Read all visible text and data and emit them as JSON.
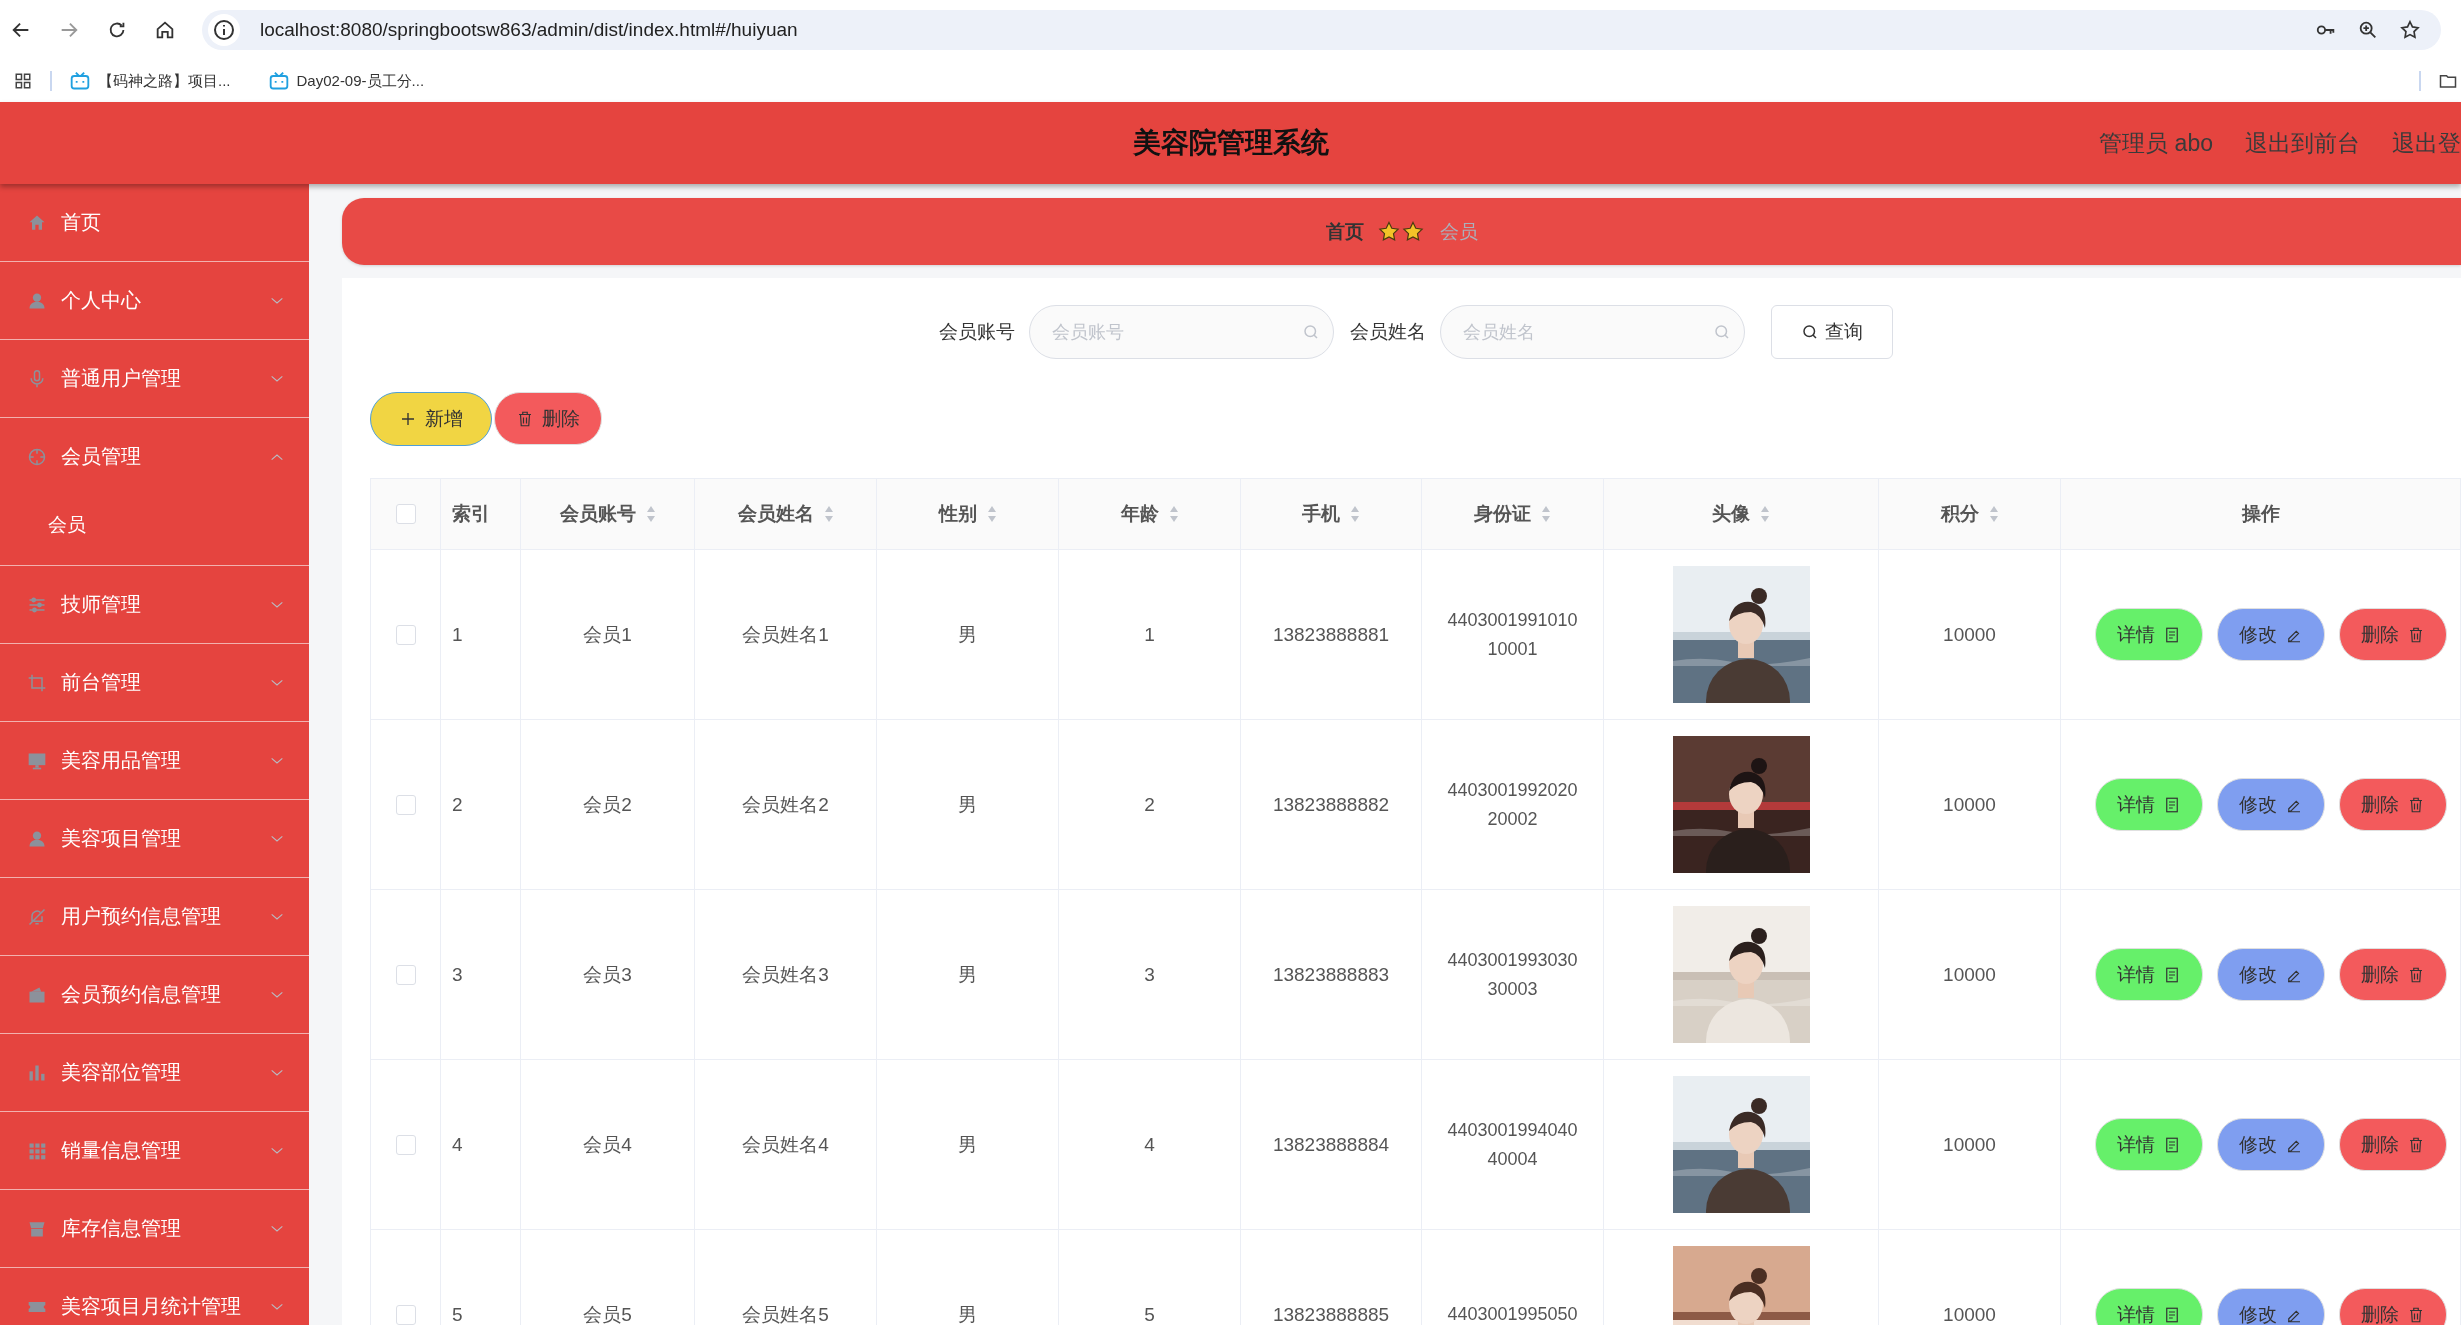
{
  "browser": {
    "url": "localhost:8080/springbootsw863/admin/dist/index.html#/huiyuan",
    "bookmarks": [
      "【码神之路】项目...",
      "Day02-09-员工分..."
    ]
  },
  "header": {
    "title": "美容院管理系统",
    "links": [
      "管理员 abo",
      "退出到前台",
      "退出登"
    ]
  },
  "sidebar": [
    {
      "label": "首页",
      "kind": "link"
    },
    {
      "label": "个人中心",
      "kind": "menu",
      "expanded": false
    },
    {
      "label": "普通用户管理",
      "kind": "menu",
      "expanded": false
    },
    {
      "label": "会员管理",
      "kind": "menu",
      "expanded": true,
      "children": [
        {
          "label": "会员"
        }
      ]
    },
    {
      "label": "技师管理",
      "kind": "menu",
      "expanded": false
    },
    {
      "label": "前台管理",
      "kind": "menu",
      "expanded": false
    },
    {
      "label": "美容用品管理",
      "kind": "menu",
      "expanded": false
    },
    {
      "label": "美容项目管理",
      "kind": "menu",
      "expanded": false
    },
    {
      "label": "用户预约信息管理",
      "kind": "menu",
      "expanded": false
    },
    {
      "label": "会员预约信息管理",
      "kind": "menu",
      "expanded": false
    },
    {
      "label": "美容部位管理",
      "kind": "menu",
      "expanded": false
    },
    {
      "label": "销量信息管理",
      "kind": "menu",
      "expanded": false
    },
    {
      "label": "库存信息管理",
      "kind": "menu",
      "expanded": false
    },
    {
      "label": "美容项目月统计管理",
      "kind": "menu",
      "expanded": false
    }
  ],
  "breadcrumb": [
    "首页",
    "会员"
  ],
  "search": {
    "fields": [
      {
        "label": "会员账号",
        "placeholder": "会员账号"
      },
      {
        "label": "会员姓名",
        "placeholder": "会员姓名"
      }
    ],
    "button": "查询"
  },
  "actions": [
    {
      "label": "新增",
      "kind": "add"
    },
    {
      "label": "删除",
      "kind": "delete"
    }
  ],
  "table": {
    "all_checked": false,
    "columns": [
      {
        "label": "索引",
        "sortable": false
      },
      {
        "label": "会员账号",
        "sortable": true
      },
      {
        "label": "会员姓名",
        "sortable": true
      },
      {
        "label": "性别",
        "sortable": true
      },
      {
        "label": "年龄",
        "sortable": true
      },
      {
        "label": "手机",
        "sortable": true
      },
      {
        "label": "身份证",
        "sortable": true
      },
      {
        "label": "头像",
        "sortable": true
      },
      {
        "label": "积分",
        "sortable": true
      },
      {
        "label": "操作",
        "sortable": false
      }
    ],
    "rows": [
      {
        "checked": false,
        "cells": [
          "1",
          "会员1",
          "会员姓名1",
          "男",
          "1",
          "13823888881",
          "440300199101010001"
        ],
        "points": "10000",
        "buttons": [
          {
            "label": "详情",
            "kind": "detail"
          },
          {
            "label": "修改",
            "kind": "edit"
          },
          {
            "label": "删除",
            "kind": "delete"
          }
        ]
      },
      {
        "checked": false,
        "cells": [
          "2",
          "会员2",
          "会员姓名2",
          "男",
          "2",
          "13823888882",
          "440300199202020002"
        ],
        "points": "10000",
        "buttons": [
          {
            "label": "详情",
            "kind": "detail"
          },
          {
            "label": "修改",
            "kind": "edit"
          },
          {
            "label": "删除",
            "kind": "delete"
          }
        ]
      },
      {
        "checked": false,
        "cells": [
          "3",
          "会员3",
          "会员姓名3",
          "男",
          "3",
          "13823888883",
          "440300199303030003"
        ],
        "points": "10000",
        "buttons": [
          {
            "label": "详情",
            "kind": "detail"
          },
          {
            "label": "修改",
            "kind": "edit"
          },
          {
            "label": "删除",
            "kind": "delete"
          }
        ]
      },
      {
        "checked": false,
        "cells": [
          "4",
          "会员4",
          "会员姓名4",
          "男",
          "4",
          "13823888884",
          "440300199404040004"
        ],
        "points": "10000",
        "buttons": [
          {
            "label": "详情",
            "kind": "detail"
          },
          {
            "label": "修改",
            "kind": "edit"
          },
          {
            "label": "删除",
            "kind": "delete"
          }
        ]
      },
      {
        "checked": false,
        "cells": [
          "5",
          "会员5",
          "会员姓名5",
          "男",
          "5",
          "13823888885",
          "4403001995050"
        ],
        "points": "10000",
        "buttons": [
          {
            "label": "详情",
            "kind": "detail"
          },
          {
            "label": "修改",
            "kind": "edit"
          },
          {
            "label": "删除",
            "kind": "delete"
          }
        ]
      }
    ]
  }
}
